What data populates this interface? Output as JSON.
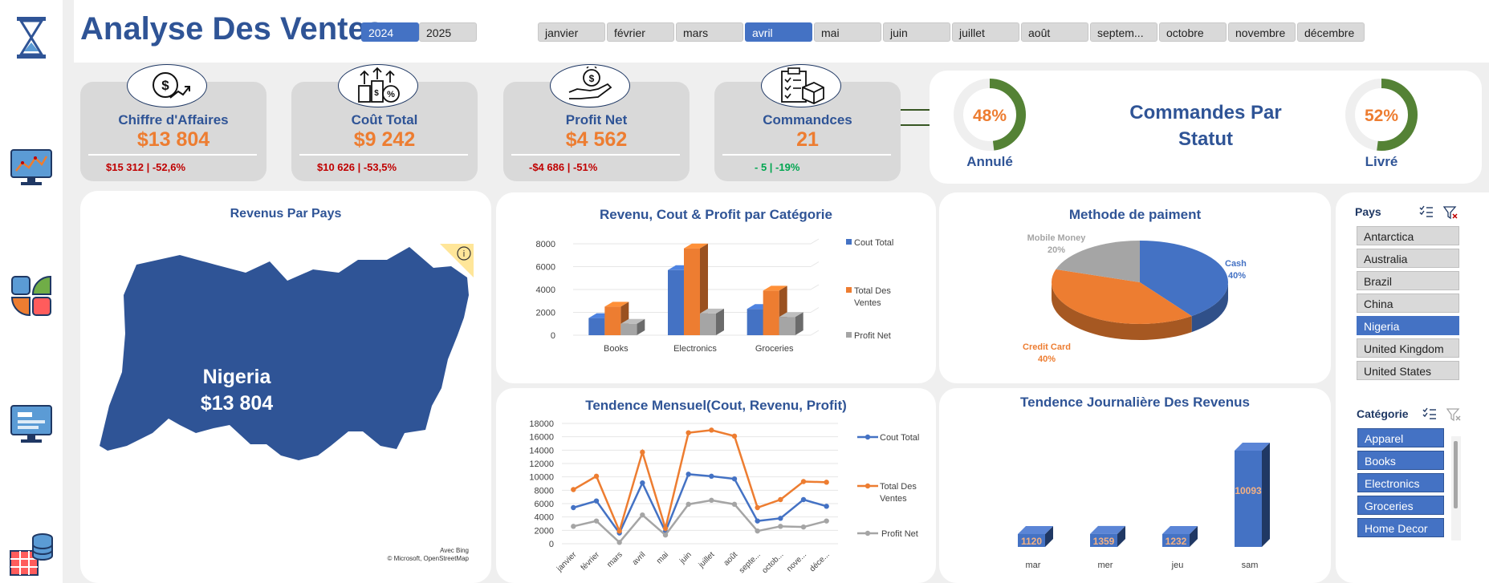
{
  "header": {
    "title": "Analyse Des Ventes",
    "years": [
      {
        "label": "2024",
        "selected": true
      },
      {
        "label": "2025",
        "selected": false
      }
    ],
    "months": [
      {
        "label": "janvier",
        "selected": false
      },
      {
        "label": "février",
        "selected": false
      },
      {
        "label": "mars",
        "selected": false
      },
      {
        "label": "avril",
        "selected": true
      },
      {
        "label": "mai",
        "selected": false
      },
      {
        "label": "juin",
        "selected": false
      },
      {
        "label": "juillet",
        "selected": false
      },
      {
        "label": "août",
        "selected": false
      },
      {
        "label": "septem...",
        "selected": false
      },
      {
        "label": "octobre",
        "selected": false
      },
      {
        "label": "novembre",
        "selected": false
      },
      {
        "label": "décembre",
        "selected": false
      }
    ]
  },
  "sidebar": {
    "icons": [
      "hourglass-icon",
      "dashboard-monitor-icon",
      "pie-grid-icon",
      "presentation-monitor-icon",
      "database-table-icon"
    ]
  },
  "kpis": [
    {
      "label": "Chiffre d'Affaires",
      "value": "$13 804",
      "sub": "$15 312 | -52,6%",
      "icon": "revenue-growth-icon",
      "trend": "down"
    },
    {
      "label": "Coût Total",
      "value": "$9 242",
      "sub": "$10 626 | -53,5%",
      "icon": "coins-percent-icon",
      "trend": "down"
    },
    {
      "label": "Profit Net",
      "value": "$4 562",
      "sub": "-$4 686 | -51%",
      "icon": "hand-money-icon",
      "trend": "down"
    },
    {
      "label": "Commandces",
      "value": "21",
      "sub": "- 5 | -19%",
      "icon": "order-checklist-icon",
      "trend": "green"
    }
  ],
  "status": {
    "title_line1": "Commandes Par",
    "title_line2": "Statut",
    "left": {
      "pct": "48%",
      "value": 0.48,
      "label": "Annulé"
    },
    "right": {
      "pct": "52%",
      "value": 0.52,
      "label": "Livré"
    }
  },
  "map": {
    "title": "Revenus Par Pays",
    "country": "Nigeria",
    "value": "$13 804",
    "credit1": "Avec Bing",
    "credit2": "© Microsoft, OpenStreetMap",
    "info_icon": "info-icon"
  },
  "category_chart": {
    "title": "Revenu, Cout & Profit par Catégorie",
    "chart_data": {
      "type": "bar",
      "categories": [
        "Books",
        "Electronics",
        "Groceries"
      ],
      "series": [
        {
          "name": "Cout  Total",
          "color": "#4472c4",
          "values": [
            1500,
            5700,
            2300
          ]
        },
        {
          "name": "Total Des Ventes",
          "color": "#ed7d31",
          "values": [
            2500,
            7600,
            3900
          ]
        },
        {
          "name": "Profit Net",
          "color": "#a5a5a5",
          "values": [
            1000,
            1900,
            1600
          ]
        }
      ],
      "yticks": [
        "0",
        "2000",
        "4000",
        "6000",
        "8000"
      ],
      "ylim": [
        0,
        8000
      ]
    }
  },
  "trend_chart": {
    "title": "Tendence Mensuel(Cout, Revenu, Profit)",
    "chart_data": {
      "type": "line",
      "categories": [
        "janvier",
        "février",
        "mars",
        "avril",
        "mai",
        "juin",
        "juillet",
        "août",
        "septe...",
        "octob...",
        "nove...",
        "déce..."
      ],
      "series": [
        {
          "name": "Cout  Total",
          "color": "#4472c4",
          "values": [
            5400,
            6400,
            1600,
            9100,
            1800,
            10400,
            10100,
            9700,
            3400,
            3800,
            6600,
            5600
          ]
        },
        {
          "name": "Total Des Ventes",
          "color": "#ed7d31",
          "values": [
            8100,
            10100,
            1900,
            13700,
            2300,
            16600,
            17000,
            16100,
            5400,
            6600,
            9300,
            9200
          ]
        },
        {
          "name": "Profit Net",
          "color": "#a5a5a5",
          "values": [
            2600,
            3400,
            200,
            4300,
            1300,
            5900,
            6500,
            5900,
            1900,
            2600,
            2500,
            3400
          ]
        }
      ],
      "yticks": [
        "0",
        "2000",
        "4000",
        "6000",
        "8000",
        "10000",
        "12000",
        "14000",
        "16000",
        "18000"
      ],
      "ylim": [
        0,
        18000
      ]
    }
  },
  "payment_chart": {
    "title": "Methode de paiment",
    "chart_data": {
      "type": "pie",
      "slices": [
        {
          "label": "Cash",
          "pct": "40%",
          "value": 40,
          "color": "#4472c4"
        },
        {
          "label": "Credit Card",
          "pct": "40%",
          "value": 40,
          "color": "#ed7d31"
        },
        {
          "label": "Mobile Money",
          "pct": "20%",
          "value": 20,
          "color": "#a5a5a5"
        }
      ]
    }
  },
  "daily_chart": {
    "title": "Tendence Journalière Des Revenus",
    "chart_data": {
      "type": "bar",
      "categories": [
        "mar",
        "mer",
        "jeu",
        "sam"
      ],
      "values": [
        1120,
        1359,
        1232,
        10093
      ],
      "labels": [
        "1120",
        "1359",
        "1232",
        "10093"
      ],
      "color": "#4472c4"
    }
  },
  "country_slicer": {
    "title": "Pays",
    "items": [
      {
        "label": "Antarctica",
        "selected": false
      },
      {
        "label": "Australia",
        "selected": false
      },
      {
        "label": "Brazil",
        "selected": false
      },
      {
        "label": "China",
        "selected": false
      },
      {
        "label": "Nigeria",
        "selected": true
      },
      {
        "label": "United Kingdom",
        "selected": false
      },
      {
        "label": "United States",
        "selected": false
      }
    ]
  },
  "category_slicer": {
    "title": "Catégorie",
    "items": [
      "Apparel",
      "Books",
      "Electronics",
      "Groceries",
      "Home Decor"
    ]
  }
}
